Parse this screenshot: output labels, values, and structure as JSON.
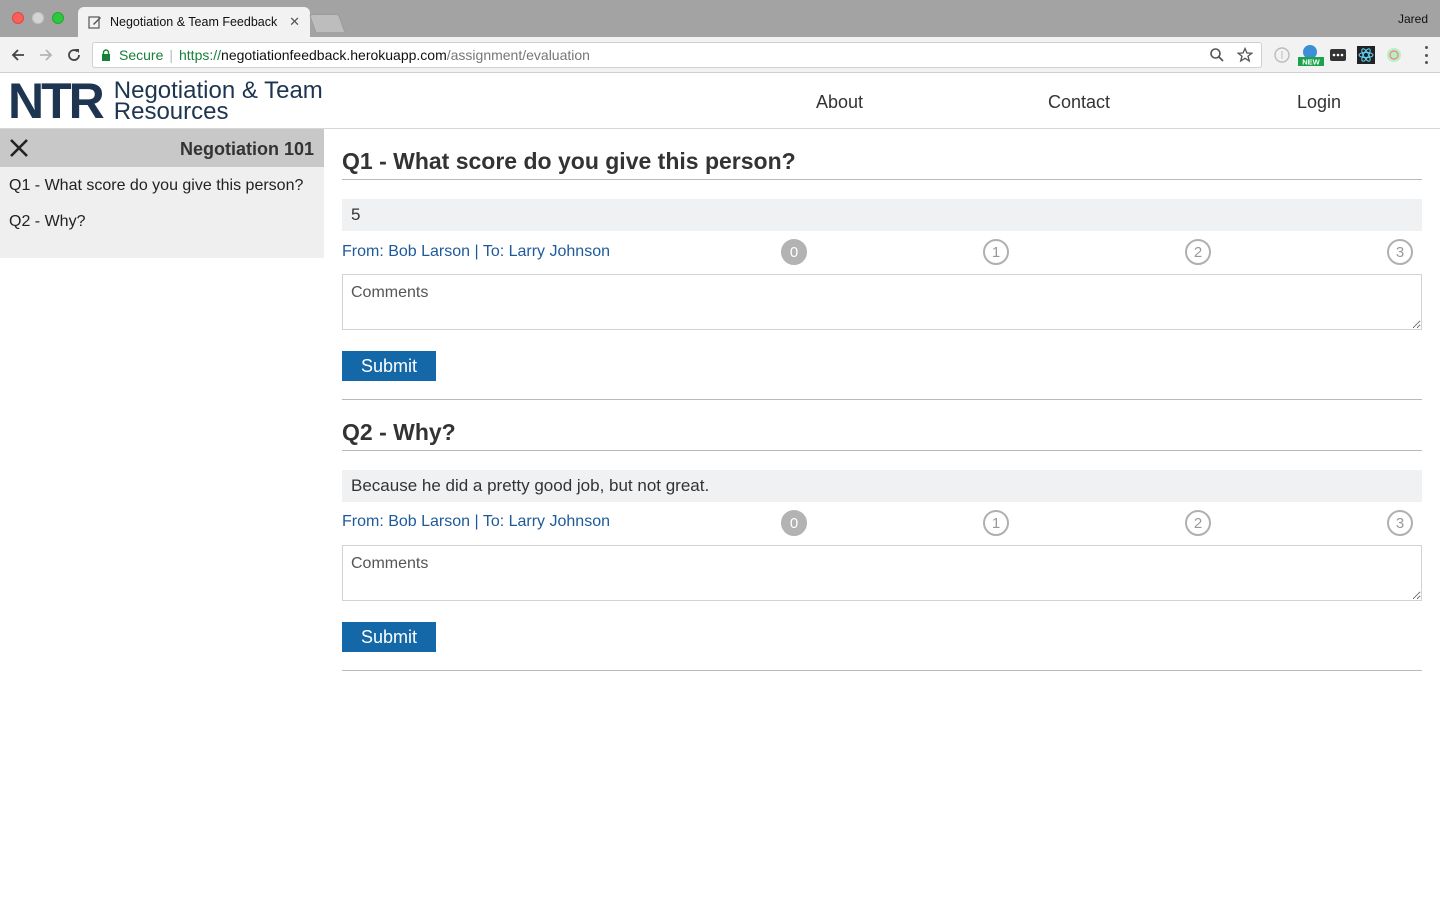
{
  "browser": {
    "tab_title": "Negotiation & Team Feedback",
    "profile_name": "Jared",
    "secure_label": "Secure",
    "url_protocol": "https://",
    "url_host": "negotiationfeedback.herokuapp.com",
    "url_path": "/assignment/evaluation",
    "extension_badge": "NEW"
  },
  "header": {
    "logo_mark": "NTR",
    "logo_line1": "Negotiation & Team",
    "logo_line2": "Resources",
    "nav": {
      "about": "About",
      "contact": "Contact",
      "login": "Login"
    }
  },
  "sidebar": {
    "title": "Negotiation 101",
    "items": [
      {
        "label": "Q1 - What score do you give this person?"
      },
      {
        "label": "Q2 - Why?"
      }
    ]
  },
  "questions": [
    {
      "title": "Q1 - What score do you give this person?",
      "answer": "5",
      "from_to": "From: Bob Larson | To: Larry Johnson",
      "scores": [
        "0",
        "1",
        "2",
        "3"
      ],
      "selected_score": 0,
      "comments_placeholder": "Comments",
      "submit_label": "Submit"
    },
    {
      "title": "Q2 - Why?",
      "answer": "Because he did a pretty good job, but not great.",
      "from_to": "From: Bob Larson | To: Larry Johnson",
      "scores": [
        "0",
        "1",
        "2",
        "3"
      ],
      "selected_score": 0,
      "comments_placeholder": "Comments",
      "submit_label": "Submit"
    }
  ],
  "colors": {
    "brand_navy": "#1d3550",
    "link_blue": "#1e5a9a",
    "button_blue": "#1568a8",
    "secure_green": "#188038"
  }
}
